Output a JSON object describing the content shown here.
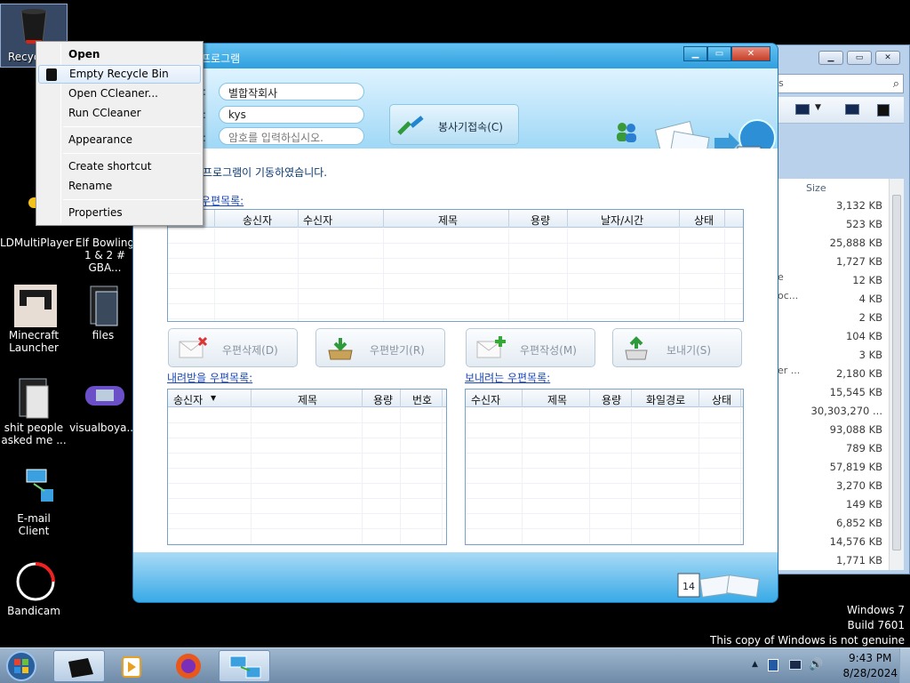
{
  "desktop": {
    "icons": [
      {
        "label": "Recyc"
      },
      {
        "label": "LDMultiPlayer"
      },
      {
        "label": "Elf Bowling 1 & 2 # GBA..."
      },
      {
        "label": "Minecraft Launcher"
      },
      {
        "label": "files"
      },
      {
        "label": "shit people asked me ..."
      },
      {
        "label": "visualboya..."
      },
      {
        "label": "E-mail Client"
      },
      {
        "label": "Bandicam"
      }
    ]
  },
  "context_menu": {
    "items": [
      "Open",
      "Empty Recycle Bin",
      "Open CCleaner...",
      "Run CCleaner",
      "Appearance",
      "Create shortcut",
      "Rename",
      "Properties"
    ]
  },
  "app": {
    "title": "프로그램",
    "fields": [
      {
        "label": ":",
        "value": "별합작회사"
      },
      {
        "label": ":",
        "value": "kys"
      },
      {
        "label": ":",
        "placeholder": "암호를 입력하십시오."
      }
    ],
    "connect_button": "봉사기접속(C)",
    "status": "프로그램이 기동하였습니다.",
    "received_title": "우편목록:",
    "received_columns": [
      "송신자",
      "수신자",
      "제목",
      "용량",
      "날자/시간",
      "상태"
    ],
    "buttons": [
      "우편삭제(D)",
      "우편받기(R)",
      "우편작성(M)",
      "보내기(S)"
    ],
    "download_title": "내려받을 우편목록:",
    "download_columns": [
      "송신자",
      "제목",
      "용량",
      "번호"
    ],
    "send_title": "보내려는 우편목록:",
    "send_columns": [
      "수신자",
      "제목",
      "용량",
      "화일경로",
      "상태"
    ]
  },
  "explorer": {
    "size_header": "Size",
    "sizes": [
      "3,132 KB",
      "523 KB",
      "25,888 KB",
      "1,727 KB",
      "12 KB",
      "4 KB",
      "2 KB",
      "104 KB",
      "3 KB",
      "2,180 KB",
      "15,545 KB",
      "30,303,270 ...",
      "93,088 KB",
      "789 KB",
      "57,819 KB",
      "3,270 KB",
      "149 KB",
      "6,852 KB",
      "14,576 KB",
      "1,771 KB"
    ],
    "fragments": [
      "s",
      "e",
      "oc...",
      "er ..."
    ]
  },
  "watermark": {
    "line1": "Windows 7",
    "line2": "Build 7601",
    "line3": "This copy of Windows is not genuine"
  },
  "clock": {
    "time": "9:43 PM",
    "date": "8/28/2024"
  },
  "colors": {
    "app_blue": "#2fa6e4",
    "link_blue": "#1a47b7",
    "taskbar": "#6e8aa8"
  }
}
